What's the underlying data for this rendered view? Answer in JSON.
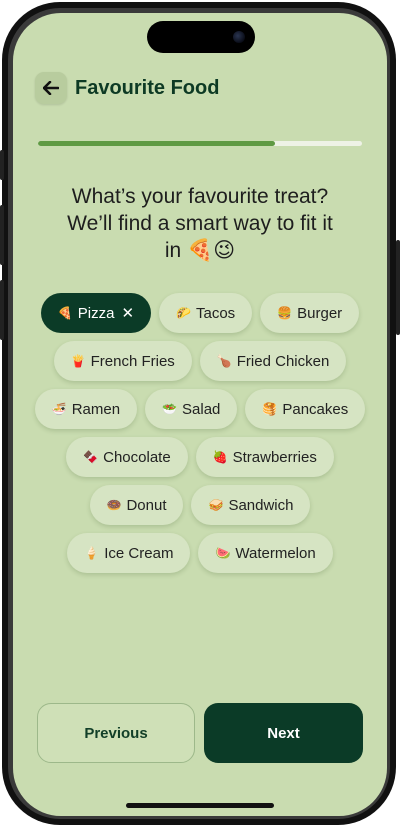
{
  "header": {
    "title": "Favourite Food",
    "back_icon": "arrow-left-icon"
  },
  "progress": {
    "fraction": 0.73
  },
  "question": {
    "line1": "What’s your favourite treat?",
    "line2": "We’ll find a smart way to fit it",
    "line3": "in 🍕😉"
  },
  "chips": [
    {
      "emoji": "🍕",
      "label": "Pizza",
      "selected": true
    },
    {
      "emoji": "🌮",
      "label": "Tacos",
      "selected": false
    },
    {
      "emoji": "🍔",
      "label": "Burger",
      "selected": false
    },
    {
      "emoji": "🍟",
      "label": "French Fries",
      "selected": false
    },
    {
      "emoji": "🍗",
      "label": "Fried Chicken",
      "selected": false
    },
    {
      "emoji": "🍜",
      "label": "Ramen",
      "selected": false
    },
    {
      "emoji": "🥗",
      "label": "Salad",
      "selected": false
    },
    {
      "emoji": "🥞",
      "label": "Pancakes",
      "selected": false
    },
    {
      "emoji": "🍫",
      "label": "Chocolate",
      "selected": false
    },
    {
      "emoji": "🍓",
      "label": "Strawberries",
      "selected": false
    },
    {
      "emoji": "🍩",
      "label": "Donut",
      "selected": false
    },
    {
      "emoji": "🥪",
      "label": "Sandwich",
      "selected": false
    },
    {
      "emoji": "🍦",
      "label": "Ice Cream",
      "selected": false
    },
    {
      "emoji": "🍉",
      "label": "Watermelon",
      "selected": false
    }
  ],
  "chip_close_glyph": "✕",
  "footer": {
    "previous_label": "Previous",
    "next_label": "Next"
  },
  "colors": {
    "background": "#c9dcb0",
    "accent_dark": "#0b3b27",
    "progress": "#5f9a43",
    "chip": "#d6e4c3"
  }
}
